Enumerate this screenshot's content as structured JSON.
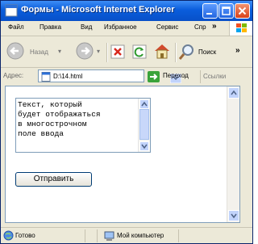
{
  "window": {
    "title": "Формы - Microsoft Internet Explorer"
  },
  "menu": {
    "items": [
      "Файл",
      "Правка",
      "Вид",
      "Избранное",
      "Сервис",
      "Спр"
    ],
    "more": "»"
  },
  "toolbar": {
    "back_label": "Назад",
    "search_label": "Поиск",
    "more": "»"
  },
  "address_bar": {
    "label": "Адрес:",
    "value": "D:\\14.html",
    "go_label": "Переход",
    "links_label": "Ссылки"
  },
  "form": {
    "textarea_text": "Текст, который\nбудет отображаться\nв многострочном\nполе ввода",
    "submit_label": "Отправить"
  },
  "status_bar": {
    "status": "Готово",
    "zone": "Мой компьютер"
  },
  "colors": {
    "titlebar": "#0a5ddc",
    "chrome": "#ece9d8",
    "accent_border": "#7f9db9"
  },
  "icons": [
    "ie-page-icon",
    "minimize-icon",
    "maximize-icon",
    "close-icon",
    "windows-logo-icon",
    "back-icon",
    "forward-icon",
    "stop-icon",
    "refresh-icon",
    "home-icon",
    "search-icon",
    "page-icon",
    "go-arrow-icon",
    "globe-icon",
    "computer-icon"
  ]
}
